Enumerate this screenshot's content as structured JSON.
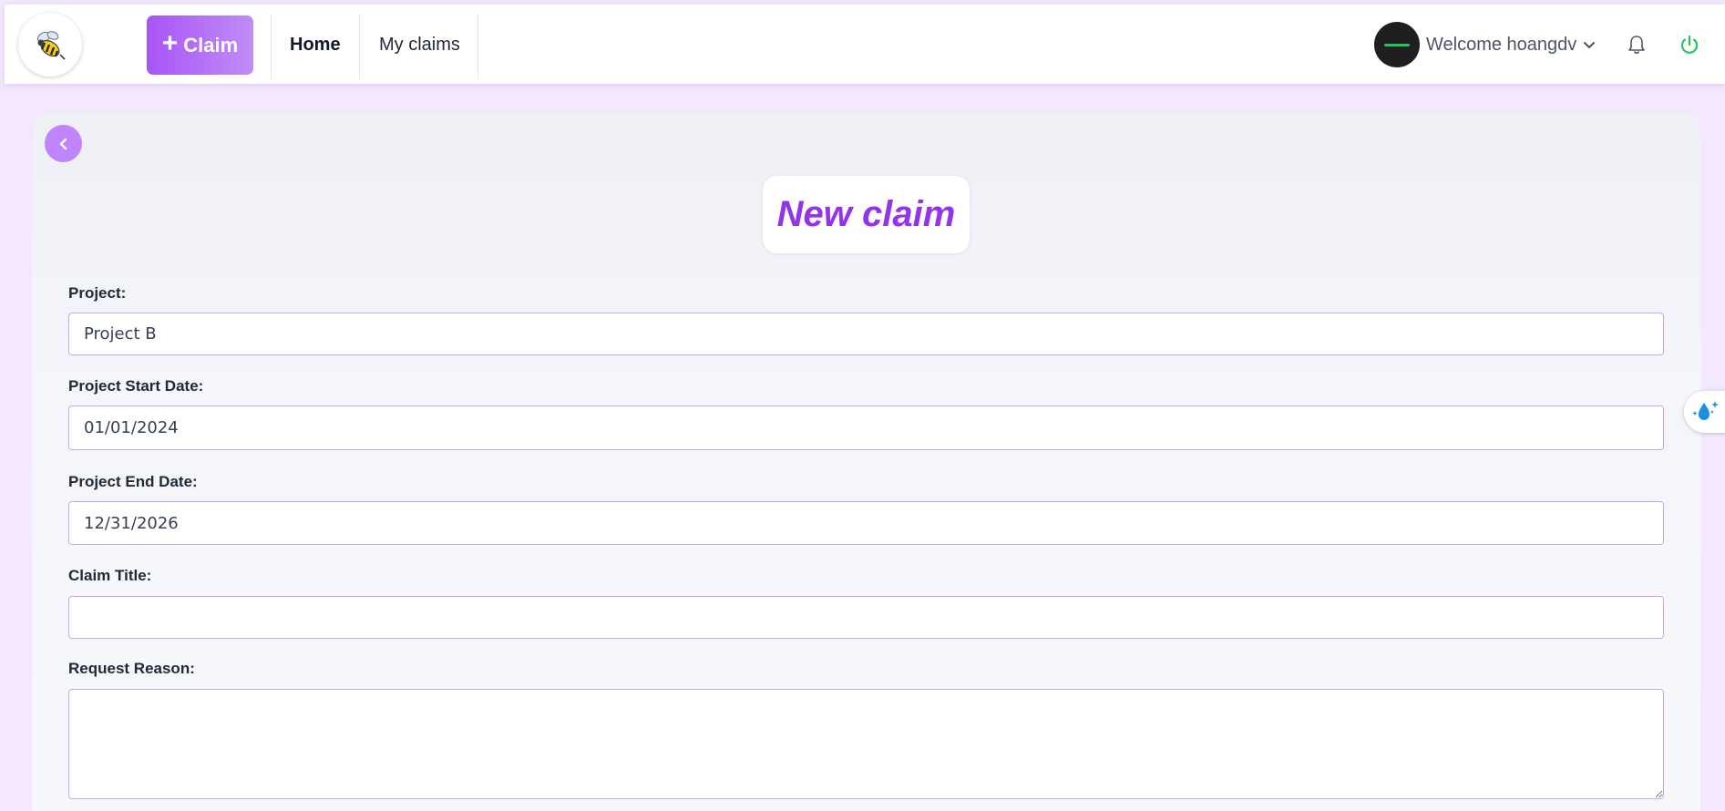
{
  "header": {
    "claim_button_label": "Claim",
    "nav": [
      {
        "label": "Home",
        "active": true
      },
      {
        "label": "My claims",
        "active": false
      }
    ],
    "welcome_text": "Welcome hoangdv",
    "icons": {
      "logo": "bee-logo-icon",
      "dropdown": "chevron-down-icon",
      "notifications": "bell-icon",
      "logout": "power-icon"
    },
    "colors": {
      "accent": "#a855f7",
      "power": "#22c55e"
    }
  },
  "page": {
    "title": "New claim",
    "back_icon": "chevron-left-icon"
  },
  "form": {
    "project": {
      "label": "Project:",
      "value": "Project B"
    },
    "start_date": {
      "label": "Project Start Date:",
      "value": "01/01/2024"
    },
    "end_date": {
      "label": "Project End Date:",
      "value": "12/31/2026"
    },
    "claim_title": {
      "label": "Claim Title:",
      "value": ""
    },
    "request_reason": {
      "label": "Request Reason:",
      "value": ""
    }
  },
  "side_widget": {
    "icon": "water-drop-sparkle-icon"
  }
}
